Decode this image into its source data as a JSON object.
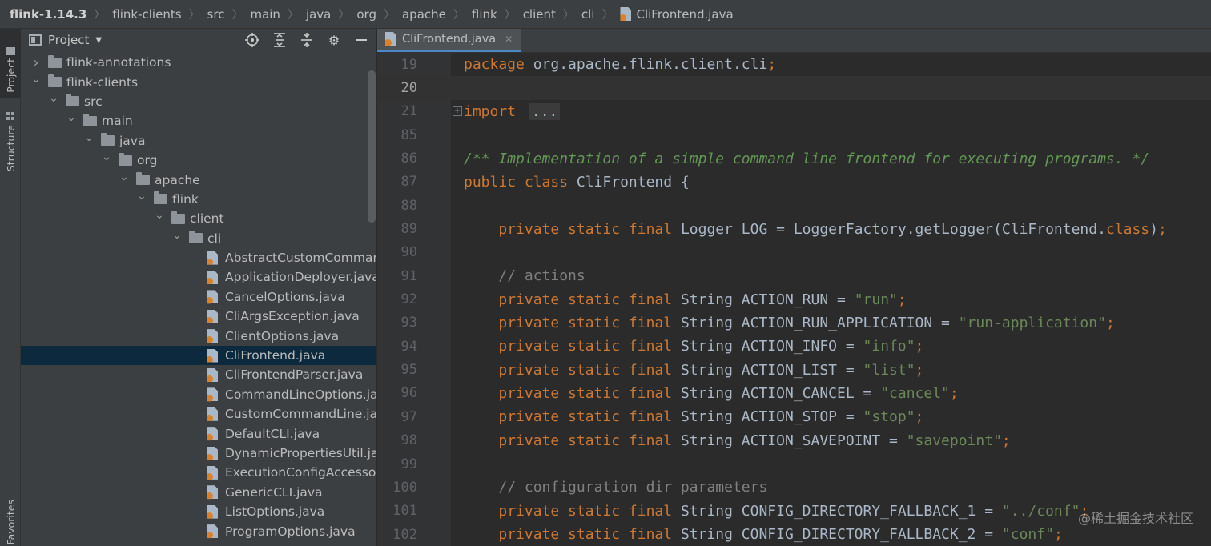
{
  "breadcrumb": {
    "items": [
      "flink-1.14.3",
      "flink-clients",
      "src",
      "main",
      "java",
      "org",
      "apache",
      "flink",
      "client",
      "cli"
    ],
    "file": "CliFrontend.java"
  },
  "tool_strip": {
    "project": "Project",
    "structure": "Structure",
    "favorites": "Favorites"
  },
  "project_panel": {
    "title": "Project",
    "tree": [
      {
        "label": "flink-annotations",
        "type": "folder",
        "depth": 0,
        "expanded": false
      },
      {
        "label": "flink-clients",
        "type": "folder",
        "depth": 0,
        "expanded": true
      },
      {
        "label": "src",
        "type": "folder",
        "depth": 1,
        "expanded": true
      },
      {
        "label": "main",
        "type": "folder",
        "depth": 2,
        "expanded": true
      },
      {
        "label": "java",
        "type": "folder",
        "depth": 3,
        "expanded": true
      },
      {
        "label": "org",
        "type": "folder",
        "depth": 4,
        "expanded": true
      },
      {
        "label": "apache",
        "type": "folder",
        "depth": 5,
        "expanded": true
      },
      {
        "label": "flink",
        "type": "folder",
        "depth": 6,
        "expanded": true
      },
      {
        "label": "client",
        "type": "folder",
        "depth": 7,
        "expanded": true
      },
      {
        "label": "cli",
        "type": "folder",
        "depth": 8,
        "expanded": true
      },
      {
        "label": "AbstractCustomComman",
        "type": "java",
        "depth": 10
      },
      {
        "label": "ApplicationDeployer.java",
        "type": "java",
        "depth": 10
      },
      {
        "label": "CancelOptions.java",
        "type": "java",
        "depth": 10
      },
      {
        "label": "CliArgsException.java",
        "type": "java",
        "depth": 10
      },
      {
        "label": "ClientOptions.java",
        "type": "java",
        "depth": 10
      },
      {
        "label": "CliFrontend.java",
        "type": "java",
        "depth": 10,
        "selected": true
      },
      {
        "label": "CliFrontendParser.java",
        "type": "java",
        "depth": 10
      },
      {
        "label": "CommandLineOptions.ja",
        "type": "java",
        "depth": 10
      },
      {
        "label": "CustomCommandLine.jav",
        "type": "java",
        "depth": 10
      },
      {
        "label": "DefaultCLI.java",
        "type": "java",
        "depth": 10
      },
      {
        "label": "DynamicPropertiesUtil.jav",
        "type": "java",
        "depth": 10
      },
      {
        "label": "ExecutionConfigAccesso",
        "type": "java",
        "depth": 10
      },
      {
        "label": "GenericCLI.java",
        "type": "java",
        "depth": 10
      },
      {
        "label": "ListOptions.java",
        "type": "java",
        "depth": 10
      },
      {
        "label": "ProgramOptions.java",
        "type": "java",
        "depth": 10
      }
    ]
  },
  "editor": {
    "tab": "CliFrontend.java",
    "current_line": "20",
    "lines": [
      {
        "n": "19",
        "tokens": [
          [
            "kw",
            "package "
          ],
          [
            "txt",
            "org.apache.flink.client.cli"
          ],
          [
            "sep",
            ";"
          ]
        ]
      },
      {
        "n": "20",
        "tokens": []
      },
      {
        "n": "21",
        "fold": true,
        "tokens": [
          [
            "kw",
            "import "
          ],
          [
            "folded",
            "..."
          ]
        ]
      },
      {
        "n": "85",
        "tokens": []
      },
      {
        "n": "86",
        "tokens": [
          [
            "doc",
            "/** Implementation of a simple command line frontend for executing programs. */"
          ]
        ]
      },
      {
        "n": "87",
        "tokens": [
          [
            "kw",
            "public class "
          ],
          [
            "txt",
            "CliFrontend {"
          ]
        ]
      },
      {
        "n": "88",
        "tokens": []
      },
      {
        "n": "89",
        "tokens": [
          [
            "txt",
            "    "
          ],
          [
            "kw",
            "private static final "
          ],
          [
            "txt",
            "Logger LOG = LoggerFactory.getLogger(CliFrontend."
          ],
          [
            "kw",
            "class"
          ],
          [
            "txt",
            ")"
          ],
          [
            "sep",
            ";"
          ]
        ]
      },
      {
        "n": "90",
        "tokens": []
      },
      {
        "n": "91",
        "tokens": [
          [
            "txt",
            "    "
          ],
          [
            "cmt",
            "// actions"
          ]
        ]
      },
      {
        "n": "92",
        "tokens": [
          [
            "txt",
            "    "
          ],
          [
            "kw",
            "private static final "
          ],
          [
            "txt",
            "String ACTION_RUN = "
          ],
          [
            "str",
            "\"run\""
          ],
          [
            "sep",
            ";"
          ]
        ]
      },
      {
        "n": "93",
        "tokens": [
          [
            "txt",
            "    "
          ],
          [
            "kw",
            "private static final "
          ],
          [
            "txt",
            "String ACTION_RUN_APPLICATION = "
          ],
          [
            "str",
            "\"run-application\""
          ],
          [
            "sep",
            ";"
          ]
        ]
      },
      {
        "n": "94",
        "tokens": [
          [
            "txt",
            "    "
          ],
          [
            "kw",
            "private static final "
          ],
          [
            "txt",
            "String ACTION_INFO = "
          ],
          [
            "str",
            "\"info\""
          ],
          [
            "sep",
            ";"
          ]
        ]
      },
      {
        "n": "95",
        "tokens": [
          [
            "txt",
            "    "
          ],
          [
            "kw",
            "private static final "
          ],
          [
            "txt",
            "String ACTION_LIST = "
          ],
          [
            "str",
            "\"list\""
          ],
          [
            "sep",
            ";"
          ]
        ]
      },
      {
        "n": "96",
        "tokens": [
          [
            "txt",
            "    "
          ],
          [
            "kw",
            "private static final "
          ],
          [
            "txt",
            "String ACTION_CANCEL = "
          ],
          [
            "str",
            "\"cancel\""
          ],
          [
            "sep",
            ";"
          ]
        ]
      },
      {
        "n": "97",
        "tokens": [
          [
            "txt",
            "    "
          ],
          [
            "kw",
            "private static final "
          ],
          [
            "txt",
            "String ACTION_STOP = "
          ],
          [
            "str",
            "\"stop\""
          ],
          [
            "sep",
            ";"
          ]
        ]
      },
      {
        "n": "98",
        "tokens": [
          [
            "txt",
            "    "
          ],
          [
            "kw",
            "private static final "
          ],
          [
            "txt",
            "String ACTION_SAVEPOINT = "
          ],
          [
            "str",
            "\"savepoint\""
          ],
          [
            "sep",
            ";"
          ]
        ]
      },
      {
        "n": "99",
        "tokens": []
      },
      {
        "n": "100",
        "tokens": [
          [
            "txt",
            "    "
          ],
          [
            "cmt",
            "// configuration dir parameters"
          ]
        ]
      },
      {
        "n": "101",
        "tokens": [
          [
            "txt",
            "    "
          ],
          [
            "kw",
            "private static final "
          ],
          [
            "txt",
            "String CONFIG_DIRECTORY_FALLBACK_1 = "
          ],
          [
            "str",
            "\"../conf\""
          ],
          [
            "sep",
            ";"
          ]
        ]
      },
      {
        "n": "102",
        "tokens": [
          [
            "txt",
            "    "
          ],
          [
            "kw",
            "private static final "
          ],
          [
            "txt",
            "String CONFIG_DIRECTORY_FALLBACK_2 = "
          ],
          [
            "str",
            "\"conf\""
          ],
          [
            "sep",
            ";"
          ]
        ]
      }
    ]
  },
  "watermark": "@稀土掘金技术社区",
  "colors": {
    "keyword": "#cc7832",
    "string": "#6a8759",
    "comment": "#808080",
    "doc_comment": "#629755",
    "selection": "#0d293e",
    "tab_underline": "#4a88c7"
  }
}
